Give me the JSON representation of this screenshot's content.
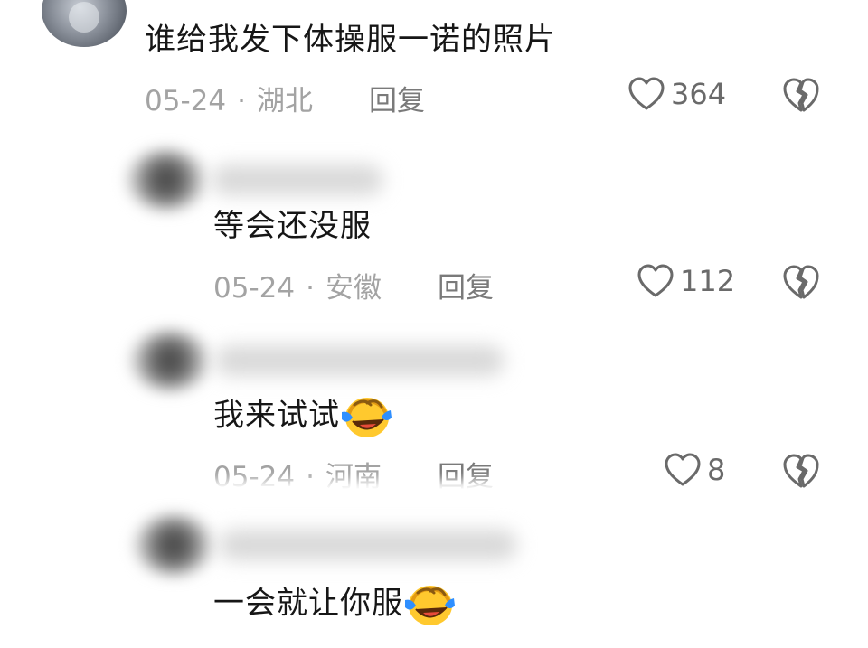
{
  "comments": [
    {
      "text": "谁给我发下体操服一诺的照片",
      "date": "05-24",
      "location": "湖北",
      "reply_label": "回复",
      "likes": "364"
    },
    {
      "text": "等会还没服",
      "date": "05-24",
      "location": "安徽",
      "reply_label": "回复",
      "likes": "112"
    },
    {
      "text": "我来试试",
      "date": "05-24",
      "location": "河南",
      "reply_label": "回复",
      "likes": "8"
    },
    {
      "text": "一会就让你服"
    }
  ],
  "separator": "·",
  "icons": {
    "like": "heart-outline-icon",
    "dislike": "broken-heart-icon",
    "emoji": "crying-laughing-emoji"
  },
  "colors": {
    "meta_gray": "#a3a3a3",
    "reply_gray": "#7a7a7a",
    "emoji_yellow": "#ffc92e",
    "emoji_blue": "#2f8fff"
  }
}
